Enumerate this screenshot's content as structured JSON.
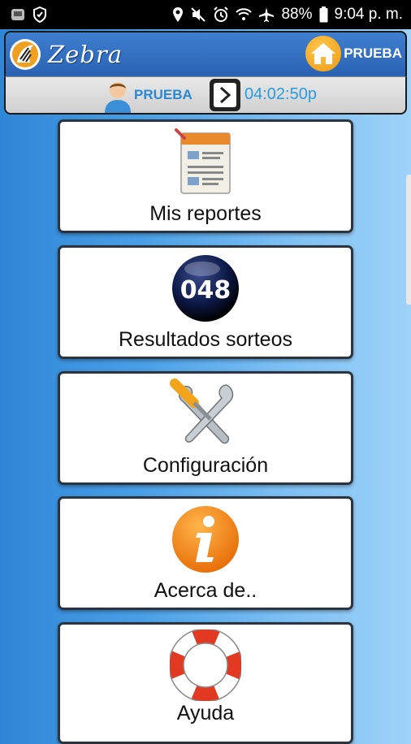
{
  "status_bar": {
    "battery": "88%",
    "time": "9:04 p. m."
  },
  "header": {
    "app_title": "Zebra",
    "home_label": "PRUEBA"
  },
  "subbar": {
    "user_name": "PRUEBA",
    "clock": "04:02:50p"
  },
  "menu": {
    "items": [
      {
        "label": "Mis reportes",
        "icon": "report-icon"
      },
      {
        "label": "Resultados sorteos",
        "icon": "lottery-ball-icon",
        "ball_number": "048"
      },
      {
        "label": "Configuración",
        "icon": "tools-icon"
      },
      {
        "label": "Acerca de..",
        "icon": "info-icon"
      },
      {
        "label": "Ayuda",
        "icon": "lifebuoy-icon"
      }
    ]
  },
  "colors": {
    "header_blue": "#2a62b3",
    "accent_orange": "#f09a12",
    "user_text": "#2a88d3"
  }
}
